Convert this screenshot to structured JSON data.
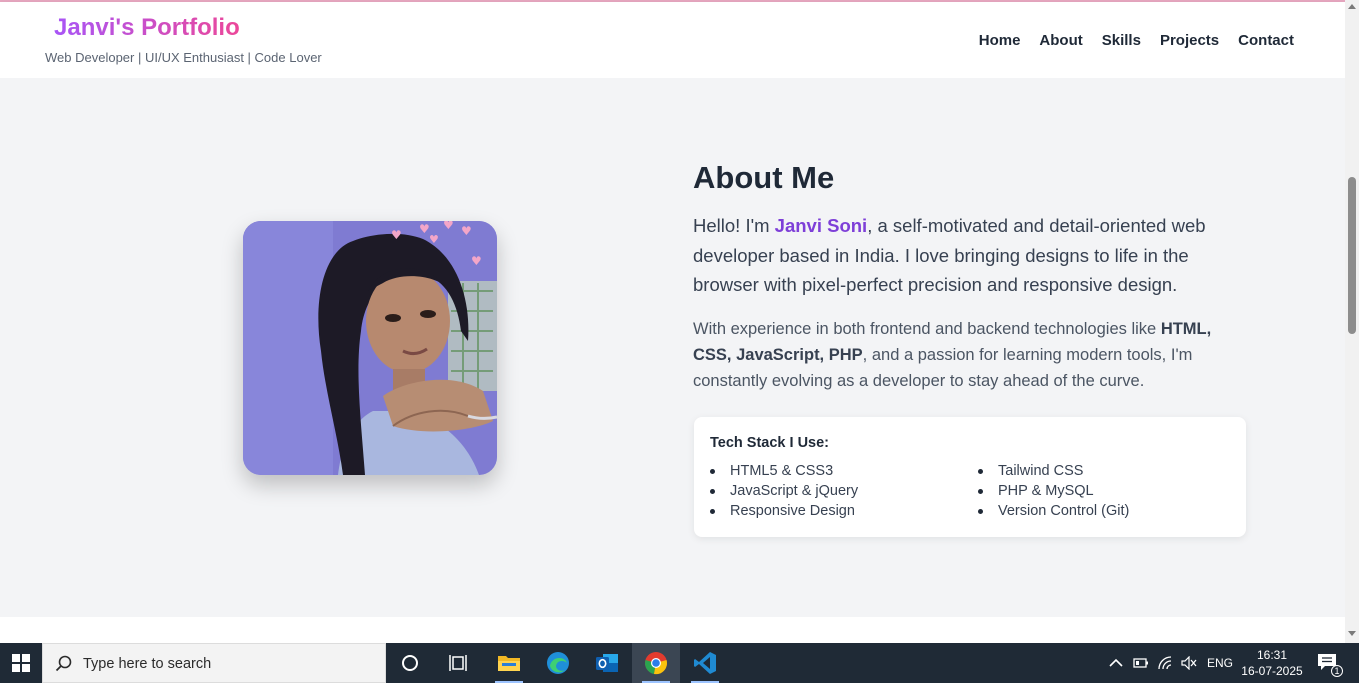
{
  "header": {
    "brand": "Janvi's Portfolio",
    "tagline": "Web Developer | UI/UX Enthusiast | Code Lover",
    "nav": [
      {
        "label": "Home"
      },
      {
        "label": "About"
      },
      {
        "label": "Skills"
      },
      {
        "label": "Projects"
      },
      {
        "label": "Contact"
      }
    ]
  },
  "about": {
    "title": "About Me",
    "lead_prefix": "Hello! I'm ",
    "lead_name": "Janvi Soni",
    "lead_suffix": ", a self-motivated and detail-oriented web developer based in India. I love bringing designs to life in the browser with pixel-perfect precision and responsive design.",
    "body_prefix": "With experience in both frontend and backend technologies like ",
    "body_tech": "HTML, CSS, JavaScript, PHP",
    "body_suffix": ", and a passion for learning modern tools, I'm constantly evolving as a developer to stay ahead of the curve.",
    "tech_title": "Tech Stack I Use:",
    "tech_col1": [
      "HTML5 & CSS3",
      "JavaScript & jQuery",
      "Responsive Design"
    ],
    "tech_col2": [
      "Tailwind CSS",
      "PHP & MySQL",
      "Version Control (Git)"
    ]
  },
  "colors": {
    "brand_gradient_start": "#a855f7",
    "brand_gradient_end": "#ec4899",
    "name_highlight": "#7e3fd8",
    "page_background": "#f3f4f6",
    "taskbar": "#1f2a36"
  },
  "taskbar": {
    "search_placeholder": "Type here to search",
    "apps": [
      "cortana-icon",
      "task-view-icon",
      "file-explorer-icon",
      "edge-icon",
      "outlook-icon",
      "chrome-icon",
      "vscode-icon"
    ],
    "language": "ENG",
    "time": "16:31",
    "date": "16-07-2025",
    "notification_count": "1"
  }
}
